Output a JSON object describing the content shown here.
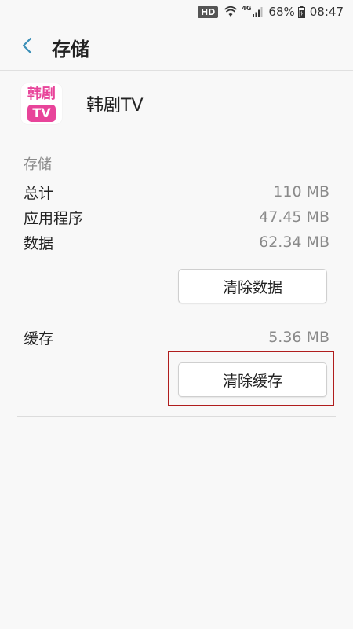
{
  "status_bar": {
    "hd_label": "HD",
    "network": "4G",
    "battery": "68%",
    "time": "08:47"
  },
  "header": {
    "title": "存储"
  },
  "app": {
    "icon_top_text": "韩剧",
    "icon_bottom_text": "TV",
    "name": "韩剧TV",
    "brand_color": "#e8449a"
  },
  "storage": {
    "section_label": "存储",
    "rows": [
      {
        "label": "总计",
        "value": "110 MB"
      },
      {
        "label": "应用程序",
        "value": "47.45 MB"
      },
      {
        "label": "数据",
        "value": "62.34 MB"
      }
    ],
    "clear_data_label": "清除数据"
  },
  "cache": {
    "label": "缓存",
    "value": "5.36 MB",
    "clear_cache_label": "清除缓存"
  },
  "colors": {
    "accent": "#3a8fb7",
    "highlight": "#b01d1d"
  }
}
